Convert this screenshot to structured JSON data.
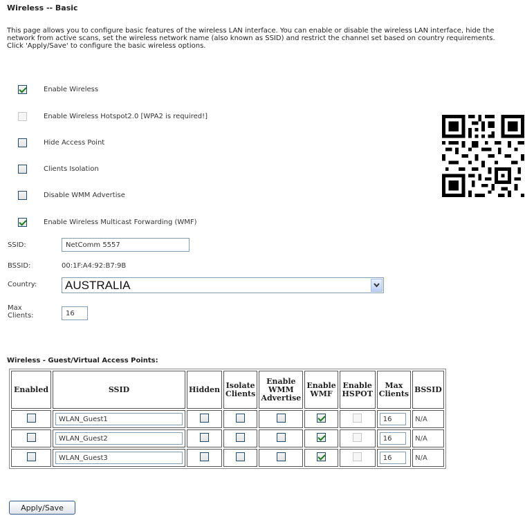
{
  "page": {
    "title": "Wireless -- Basic",
    "description_1": "This page allows you to configure basic features of the wireless LAN interface. You can enable or disable the wireless LAN interface, hide the network from active scans, set the wireless network name (also known as SSID) and restrict the channel set based on country requirements.",
    "description_2": "Click 'Apply/Save' to configure the basic wireless options."
  },
  "options": [
    {
      "label": "Enable Wireless",
      "checked": true,
      "disabled": false
    },
    {
      "label": "Enable Wireless Hotspot2.0 [WPA2 is required!]",
      "checked": false,
      "disabled": true
    },
    {
      "label": "Hide Access Point",
      "checked": false,
      "disabled": false
    },
    {
      "label": "Clients Isolation",
      "checked": false,
      "disabled": false
    },
    {
      "label": "Disable WMM Advertise",
      "checked": false,
      "disabled": false
    },
    {
      "label": "Enable Wireless Multicast Forwarding (WMF)",
      "checked": true,
      "disabled": false
    }
  ],
  "fields": {
    "ssid_label": "SSID:",
    "ssid_value": "NetComm 5557",
    "bssid_label": "BSSID:",
    "bssid_value": "00:1F:A4:92:B7:9B",
    "country_label": "Country:",
    "country_value": "AUSTRALIA",
    "max_clients_label_1": "Max",
    "max_clients_label_2": "Clients:",
    "max_clients_value": "16"
  },
  "guest": {
    "section_title": "Wireless - Guest/Virtual Access Points:",
    "headers": {
      "enabled": "Enabled",
      "ssid": "SSID",
      "hidden": "Hidden",
      "isolate_1": "Isolate",
      "isolate_2": "Clients",
      "wmm_1": "Enable",
      "wmm_2": "WMM",
      "wmm_3": "Advertise",
      "wmf_1": "Enable",
      "wmf_2": "WMF",
      "hspot_1": "Enable",
      "hspot_2": "HSPOT",
      "max_1": "Max",
      "max_2": "Clients",
      "bssid": "BSSID"
    },
    "rows": [
      {
        "ssid": "WLAN_Guest1",
        "max_clients": "16",
        "bssid": "N/A"
      },
      {
        "ssid": "WLAN_Guest2",
        "max_clients": "16",
        "bssid": "N/A"
      },
      {
        "ssid": "WLAN_Guest3",
        "max_clients": "16",
        "bssid": "N/A"
      }
    ]
  },
  "buttons": {
    "apply_save": "Apply/Save"
  },
  "icons": {
    "qr": "qr-code-icon",
    "dropdown": "chevron-down-icon"
  }
}
